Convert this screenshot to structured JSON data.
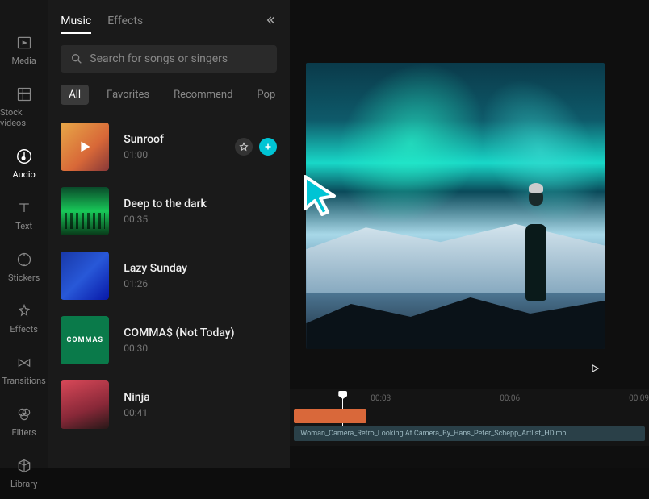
{
  "nav": [
    {
      "label": "Media",
      "icon": "media-icon"
    },
    {
      "label": "Stock videos",
      "icon": "stock-icon"
    },
    {
      "label": "Audio",
      "icon": "audio-icon",
      "active": true
    },
    {
      "label": "Text",
      "icon": "text-icon"
    },
    {
      "label": "Stickers",
      "icon": "stickers-icon"
    },
    {
      "label": "Effects",
      "icon": "effects-icon"
    },
    {
      "label": "Transitions",
      "icon": "transitions-icon"
    },
    {
      "label": "Filters",
      "icon": "filters-icon"
    },
    {
      "label": "Library",
      "icon": "library-icon"
    }
  ],
  "tabs": {
    "music": "Music",
    "effects": "Effects"
  },
  "search": {
    "placeholder": "Search for songs or singers"
  },
  "filters": {
    "all": "All",
    "favorites": "Favorites",
    "recommend": "Recommend",
    "pop": "Pop"
  },
  "tracks": [
    {
      "title": "Sunroof",
      "duration": "01:00",
      "thumbClass": "thumb-sunroof",
      "showPlay": true,
      "showActions": true
    },
    {
      "title": "Deep to the dark",
      "duration": "00:35",
      "thumbClass": "thumb-deep"
    },
    {
      "title": "Lazy Sunday",
      "duration": "01:26",
      "thumbClass": "thumb-lazy"
    },
    {
      "title": "COMMA$ (Not Today)",
      "duration": "00:30",
      "thumbClass": "thumb-commas",
      "thumbText": "COMMAS"
    },
    {
      "title": "Ninja",
      "duration": "00:41",
      "thumbClass": "thumb-ninja"
    }
  ],
  "timeline": {
    "ticks": [
      "00:03",
      "00:06",
      "00:09"
    ],
    "clipLabel": "Woman_Camera_Retro_Looking At Camera_By_Hans_Peter_Schepp_Artlist_HD.mp"
  },
  "colors": {
    "accent": "#00c4d4"
  }
}
